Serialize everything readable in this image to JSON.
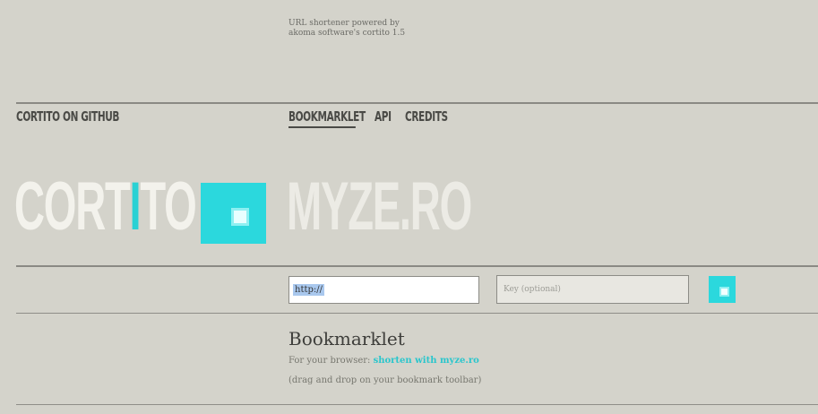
{
  "header": {
    "powered_line1": "URL shortener powered by",
    "powered_line2": "akoma software's cortito 1.5"
  },
  "nav": {
    "github": "CORTITO ON GITHUB",
    "items": [
      {
        "label": "BOOKMARKLET",
        "active": true
      },
      {
        "label": "API",
        "active": false
      },
      {
        "label": "CREDITS",
        "active": false
      }
    ]
  },
  "logo": {
    "part1": "CORT",
    "highlight": "I",
    "part2": "TO",
    "domain": "MYZE.RO",
    "accent_color": "#2bd8dd"
  },
  "form": {
    "url_value": "http://",
    "key_placeholder": "Key (optional)",
    "submit_icon": "square-icon"
  },
  "bookmarklet": {
    "title": "Bookmarklet",
    "prefix": "For your browser:",
    "link": "shorten with myze.ro",
    "hint": "(drag and drop on your bookmark toolbar)"
  }
}
